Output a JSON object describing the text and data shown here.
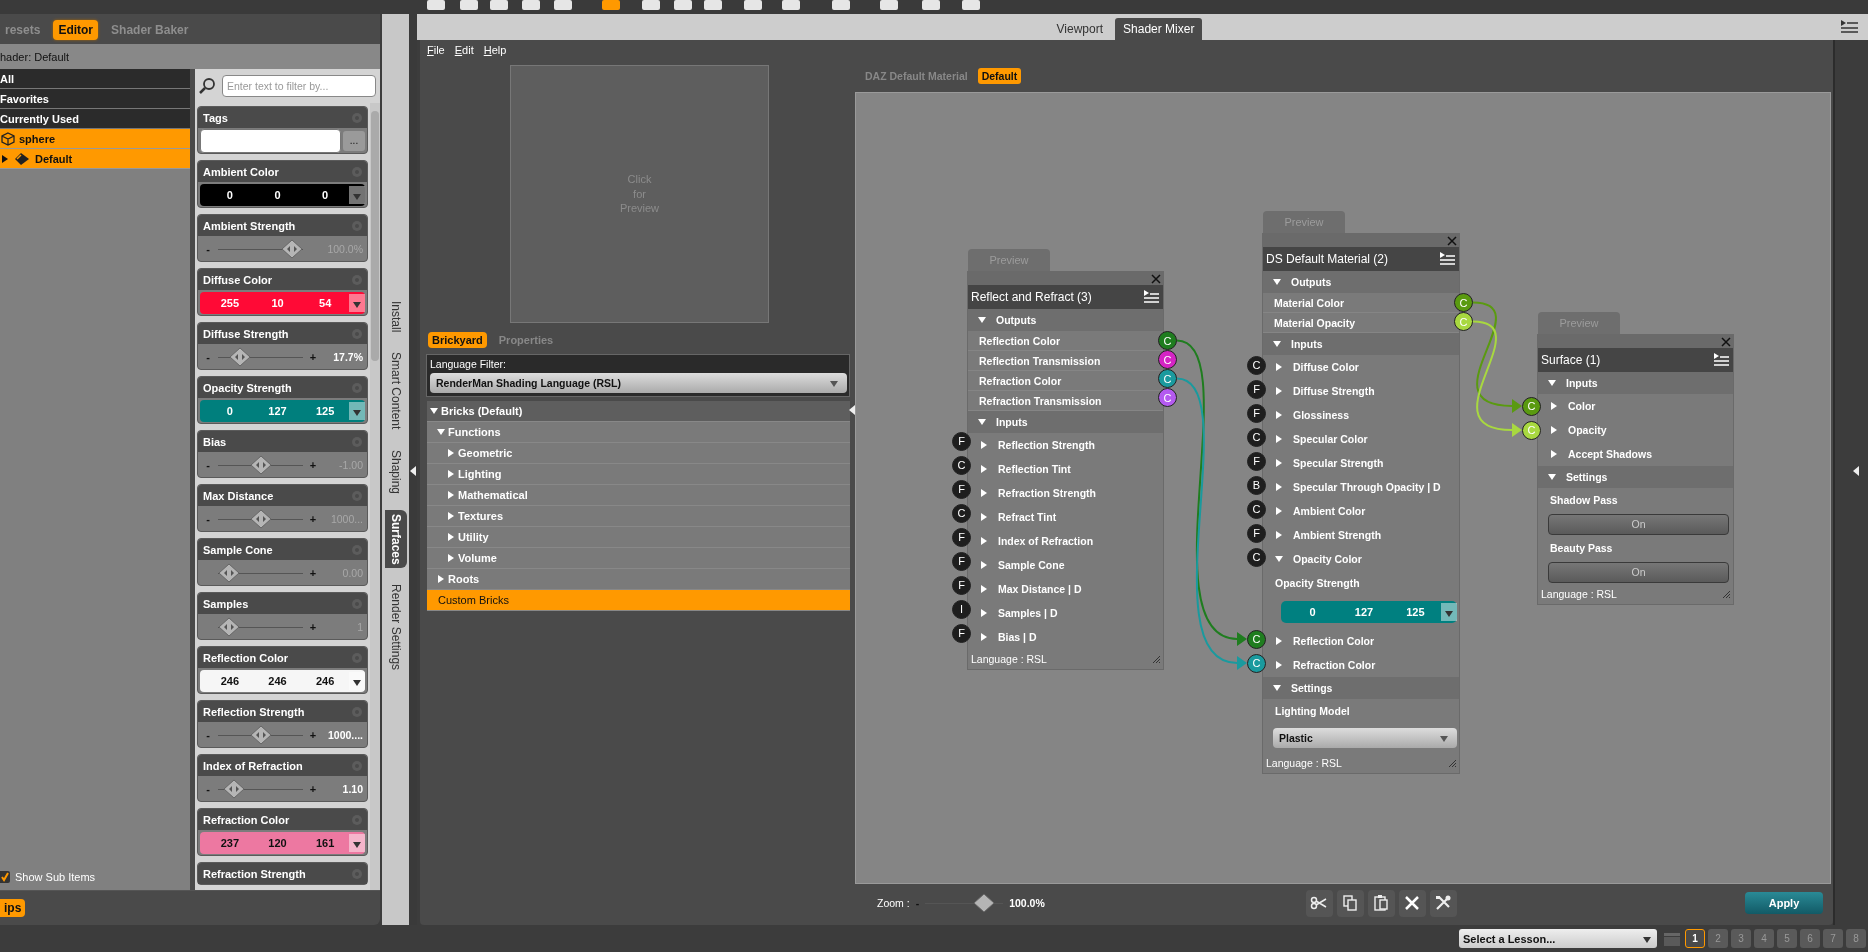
{
  "left_panel": {
    "tabs": [
      {
        "label": "resets",
        "selected": false
      },
      {
        "label": "Editor",
        "selected": true
      },
      {
        "label": "Shader Baker",
        "selected": false
      }
    ],
    "shader_label": "hader: Default",
    "groups": [
      {
        "label": "All",
        "selected": false
      },
      {
        "label": "Favorites",
        "selected": false
      },
      {
        "label": "Currently Used",
        "selected": false
      }
    ],
    "scene_tree": [
      {
        "label": "sphere",
        "kind": "object",
        "selected": true,
        "children": [
          {
            "label": "Default",
            "kind": "surface",
            "selected": true,
            "expanded": false
          }
        ]
      }
    ],
    "filter": {
      "placeholder": "Enter text to filter by..."
    },
    "properties": [
      {
        "kind": "tags",
        "label": "Tags",
        "button": "..."
      },
      {
        "kind": "color",
        "label": "Ambient Color",
        "values": [
          "0",
          "0",
          "0"
        ],
        "color": "#000000"
      },
      {
        "kind": "slider",
        "label": "Ambient Strength",
        "minus": "-",
        "level": 1,
        "reading": "100.0%",
        "dimmed": true
      },
      {
        "kind": "color",
        "label": "Diffuse Color",
        "values": [
          "255",
          "10",
          "54"
        ],
        "color": "#ff0a36"
      },
      {
        "kind": "slider",
        "label": "Diffuse Strength",
        "minus": "-",
        "plus": "+",
        "level": 0.177,
        "reading": "17.7%",
        "dimmed": false
      },
      {
        "kind": "color",
        "label": "Opacity Strength",
        "values": [
          "0",
          "127",
          "125"
        ],
        "color": "#007f7d"
      },
      {
        "kind": "slider",
        "label": "Bias",
        "minus": "-",
        "plus": "+",
        "level": 0.5,
        "reading": "-1.00",
        "dimmed": true
      },
      {
        "kind": "slider",
        "label": "Max Distance",
        "minus": "-",
        "plus": "+",
        "level": 0.5,
        "reading": "1000...",
        "dimmed": true
      },
      {
        "kind": "slider",
        "label": "Sample Cone",
        "plus": "+",
        "level": 0,
        "reading": "0.00",
        "dimmed": true
      },
      {
        "kind": "slider",
        "label": "Samples",
        "plus": "+",
        "level": 0,
        "reading": "1",
        "dimmed": true
      },
      {
        "kind": "color",
        "label": "Reflection Color",
        "values": [
          "246",
          "246",
          "246"
        ],
        "color": "#f6f6f6"
      },
      {
        "kind": "slider",
        "label": "Reflection Strength",
        "minus": "-",
        "plus": "+",
        "level": 0.5,
        "reading": "1000....",
        "dimmed": false
      },
      {
        "kind": "slider",
        "label": "Index of Refraction",
        "minus": "-",
        "plus": "+",
        "level": 0.08,
        "reading": "1.10",
        "dimmed": false
      },
      {
        "kind": "color",
        "label": "Refraction Color",
        "values": [
          "237",
          "120",
          "161"
        ],
        "color": "#ed78a1"
      },
      {
        "kind": "heading",
        "label": "Refraction Strength"
      }
    ],
    "show_sub_items": {
      "label": "Show Sub Items",
      "checked": true
    },
    "tips": "ips"
  },
  "side_tabs": [
    {
      "label": "Install",
      "selected": false
    },
    {
      "label": "Smart Content",
      "selected": false
    },
    {
      "label": "Shaping",
      "selected": false
    },
    {
      "label": "Surfaces",
      "selected": true
    },
    {
      "label": "Render Settings",
      "selected": false
    }
  ],
  "main_tabs": [
    {
      "label": "Viewport",
      "selected": false
    },
    {
      "label": "Shader Mixer",
      "selected": true
    }
  ],
  "menu": [
    "File",
    "Edit",
    "Help"
  ],
  "preview_text": "Click for Preview",
  "brickyard": {
    "tabs": [
      {
        "label": "Brickyard",
        "selected": true
      },
      {
        "label": "Properties",
        "selected": false
      }
    ],
    "filter_label": "Language Filter:",
    "filter_value": "RenderMan Shading Language (RSL)",
    "tree": [
      {
        "label": "Bricks (Default)",
        "expanded": true,
        "selected": false,
        "children": [
          {
            "label": "Functions",
            "expanded": true,
            "selected": false,
            "children": [
              {
                "label": "Geometric",
                "expanded": false,
                "selected": false
              },
              {
                "label": "Lighting",
                "expanded": false,
                "selected": false
              },
              {
                "label": "Mathematical",
                "expanded": false,
                "selected": false
              },
              {
                "label": "Textures",
                "expanded": false,
                "selected": false
              },
              {
                "label": "Utility",
                "expanded": false,
                "selected": false
              },
              {
                "label": "Volume",
                "expanded": false,
                "selected": false
              }
            ]
          },
          {
            "label": "Roots",
            "expanded": false,
            "selected": false
          }
        ]
      },
      {
        "label": "Custom Bricks",
        "selected": true
      }
    ]
  },
  "canvas": {
    "tabs": [
      {
        "label": "DAZ Default Material",
        "selected": false
      },
      {
        "label": "Default",
        "selected": true
      }
    ],
    "nodes": [
      {
        "title": "Reflect and Refract (3)",
        "preview": "Preview",
        "footer": "Language : RSL",
        "sections": [
          {
            "label": "Outputs",
            "expanded": true,
            "rows": [
              {
                "kind": "output",
                "label": "Reflection Color",
                "port": "C",
                "color": "#1f7d1f"
              },
              {
                "kind": "output",
                "label": "Reflection Transmission",
                "port": "C",
                "color": "#d424c4"
              },
              {
                "kind": "output",
                "label": "Refraction Color",
                "port": "C",
                "color": "#1a9a9e"
              },
              {
                "kind": "output",
                "label": "Refraction Transmission",
                "port": "C",
                "color": "#b45af0"
              }
            ]
          },
          {
            "label": "Inputs",
            "expanded": true,
            "rows": [
              {
                "kind": "input",
                "label": "Reflection Strength",
                "port": "F",
                "color": "#1e1e1e",
                "expanded": false
              },
              {
                "kind": "input",
                "label": "Reflection Tint",
                "port": "C",
                "color": "#1e1e1e",
                "expanded": false
              },
              {
                "kind": "input",
                "label": "Refraction Strength",
                "port": "F",
                "color": "#1e1e1e",
                "expanded": false
              },
              {
                "kind": "input",
                "label": "Refract Tint",
                "port": "C",
                "color": "#1e1e1e",
                "expanded": false
              },
              {
                "kind": "input",
                "label": "Index of Refraction",
                "port": "F",
                "color": "#1e1e1e",
                "expanded": false
              },
              {
                "kind": "input",
                "label": "Sample Cone",
                "port": "F",
                "color": "#1e1e1e",
                "expanded": false
              },
              {
                "kind": "input",
                "label": "Max Distance  | D",
                "port": "F",
                "color": "#1e1e1e",
                "expanded": false
              },
              {
                "kind": "input",
                "label": "Samples  | D",
                "port": "I",
                "color": "#1e1e1e",
                "expanded": false
              },
              {
                "kind": "input",
                "label": "Bias  | D",
                "port": "F",
                "color": "#1e1e1e",
                "expanded": false
              }
            ]
          }
        ]
      },
      {
        "title": "DS Default Material (2)",
        "preview": "Preview",
        "footer": "Language : RSL",
        "sections": [
          {
            "label": "Outputs",
            "expanded": true,
            "rows": [
              {
                "kind": "output",
                "label": "Material Color",
                "port": "C",
                "color": "#5a9a10"
              },
              {
                "kind": "output",
                "label": "Material Opacity",
                "port": "C",
                "color": "#a8d840"
              }
            ]
          },
          {
            "label": "Inputs",
            "expanded": true,
            "rows": [
              {
                "kind": "input",
                "label": "Diffuse Color",
                "port": "C",
                "color": "#1e1e1e",
                "expanded": false
              },
              {
                "kind": "input",
                "label": "Diffuse Strength",
                "port": "F",
                "color": "#1e1e1e",
                "expanded": false
              },
              {
                "kind": "input",
                "label": "Glossiness",
                "port": "F",
                "color": "#1e1e1e",
                "expanded": false
              },
              {
                "kind": "input",
                "label": "Specular Color",
                "port": "C",
                "color": "#1e1e1e",
                "expanded": false
              },
              {
                "kind": "input",
                "label": "Specular Strength",
                "port": "F",
                "color": "#1e1e1e",
                "expanded": false
              },
              {
                "kind": "input",
                "label": "Specular Through Opacity  | D",
                "port": "B",
                "color": "#1e1e1e",
                "expanded": false
              },
              {
                "kind": "input",
                "label": "Ambient Color",
                "port": "C",
                "color": "#1e1e1e",
                "expanded": false
              },
              {
                "kind": "input",
                "label": "Ambient Strength",
                "port": "F",
                "color": "#1e1e1e",
                "expanded": false
              },
              {
                "kind": "input",
                "label": "Opacity Color",
                "port": "C",
                "color": "#1e1e1e",
                "expanded": true
              },
              {
                "kind": "label",
                "label": "Opacity Strength"
              },
              {
                "kind": "color_field",
                "values": [
                  "0",
                  "127",
                  "125"
                ],
                "color": "#008080"
              },
              {
                "kind": "input",
                "label": "Reflection Color",
                "port": "C",
                "color": "#1f7d1f",
                "expanded": false
              },
              {
                "kind": "input",
                "label": "Refraction Color",
                "port": "C",
                "color": "#1a9a9e",
                "expanded": false
              }
            ]
          },
          {
            "label": "Settings",
            "expanded": true,
            "rows": [
              {
                "kind": "label",
                "label": "Lighting Model"
              },
              {
                "kind": "dropdown",
                "value": "Plastic"
              }
            ]
          }
        ]
      },
      {
        "title": "Surface (1)",
        "preview": "Preview",
        "footer": "Language : RSL",
        "sections": [
          {
            "label": "Inputs",
            "expanded": true,
            "rows": [
              {
                "kind": "input",
                "label": "Color",
                "port": "C",
                "color": "#5a9a10",
                "expanded": false
              },
              {
                "kind": "input",
                "label": "Opacity",
                "port": "C",
                "color": "#a8d840",
                "expanded": false
              },
              {
                "kind": "input",
                "label": "Accept Shadows",
                "expanded": false
              }
            ]
          },
          {
            "label": "Settings",
            "expanded": true,
            "rows": [
              {
                "kind": "label",
                "label": "Shadow Pass"
              },
              {
                "kind": "toggle",
                "value": "On"
              },
              {
                "kind": "label",
                "label": "Beauty Pass"
              },
              {
                "kind": "toggle",
                "value": "On"
              }
            ]
          }
        ]
      }
    ],
    "zoom": {
      "label": "Zoom :",
      "minus": "-",
      "level": 0.85,
      "reading": "100.0%"
    },
    "apply": "Apply"
  },
  "lesson": {
    "value": "Select a Lesson...",
    "pages": [
      {
        "label": "1",
        "selected": true
      },
      {
        "label": "2",
        "selected": false
      },
      {
        "label": "3",
        "selected": false
      },
      {
        "label": "4",
        "selected": false
      },
      {
        "label": "5",
        "selected": false
      },
      {
        "label": "6",
        "selected": false
      },
      {
        "label": "7",
        "selected": false
      },
      {
        "label": "8",
        "selected": false
      }
    ]
  }
}
